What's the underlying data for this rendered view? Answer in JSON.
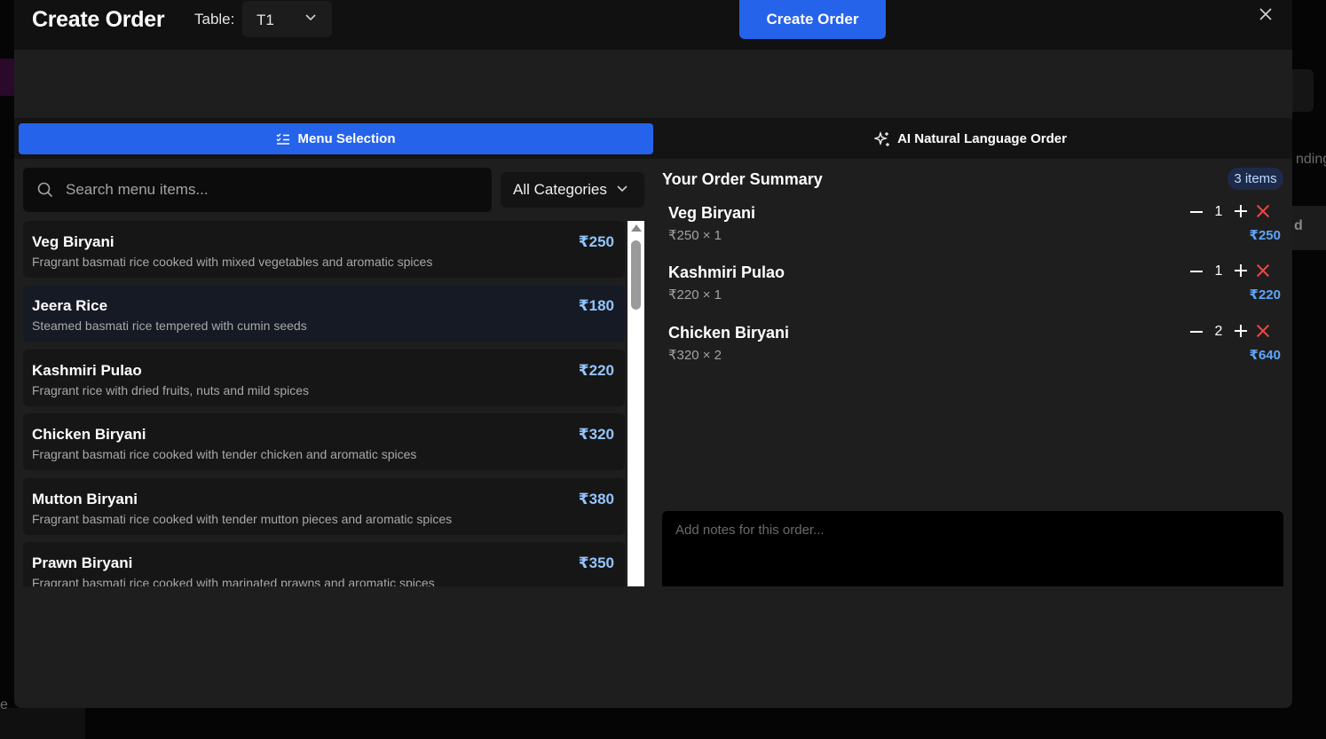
{
  "background": {
    "frag_nding": "nding",
    "frag_d": "d",
    "frag_e": "e"
  },
  "header": {
    "title": "Create Order",
    "table_label": "Table:",
    "table_value": "T1",
    "create_button": "Create Order"
  },
  "tabs": [
    {
      "label": "Menu Selection",
      "icon": "list-check-icon",
      "active": true
    },
    {
      "label": "AI Natural Language Order",
      "icon": "sparkles-icon",
      "active": false
    }
  ],
  "search": {
    "placeholder": "Search menu items..."
  },
  "category_filter": {
    "value": "All Categories"
  },
  "menu": [
    {
      "name": "Veg Biryani",
      "description": "Fragrant basmati rice cooked with mixed vegetables and aromatic spices",
      "price": "₹250"
    },
    {
      "name": "Jeera Rice",
      "description": "Steamed basmati rice tempered with cumin seeds",
      "price": "₹180"
    },
    {
      "name": "Kashmiri Pulao",
      "description": "Fragrant rice with dried fruits, nuts and mild spices",
      "price": "₹220"
    },
    {
      "name": "Chicken Biryani",
      "description": "Fragrant basmati rice cooked with tender chicken and aromatic spices",
      "price": "₹320"
    },
    {
      "name": "Mutton Biryani",
      "description": "Fragrant basmati rice cooked with tender mutton pieces and aromatic spices",
      "price": "₹380"
    },
    {
      "name": "Prawn Biryani",
      "description": "Fragrant basmati rice cooked with marinated prawns and aromatic spices",
      "price": "₹350"
    }
  ],
  "summary": {
    "title": "Your Order Summary",
    "count_badge": "3 items",
    "items": [
      {
        "name": "Veg Biryani",
        "detail": "₹250 × 1",
        "qty": "1",
        "total": "₹250"
      },
      {
        "name": "Kashmiri Pulao",
        "detail": "₹220 × 1",
        "qty": "1",
        "total": "₹220"
      },
      {
        "name": "Chicken Biryani",
        "detail": "₹320 × 2",
        "qty": "2",
        "total": "₹640"
      }
    ],
    "notes_placeholder": "Add notes for this order..."
  },
  "colors": {
    "accent": "#2563eb",
    "price": "#93c5fd",
    "remove": "#ef4444"
  }
}
